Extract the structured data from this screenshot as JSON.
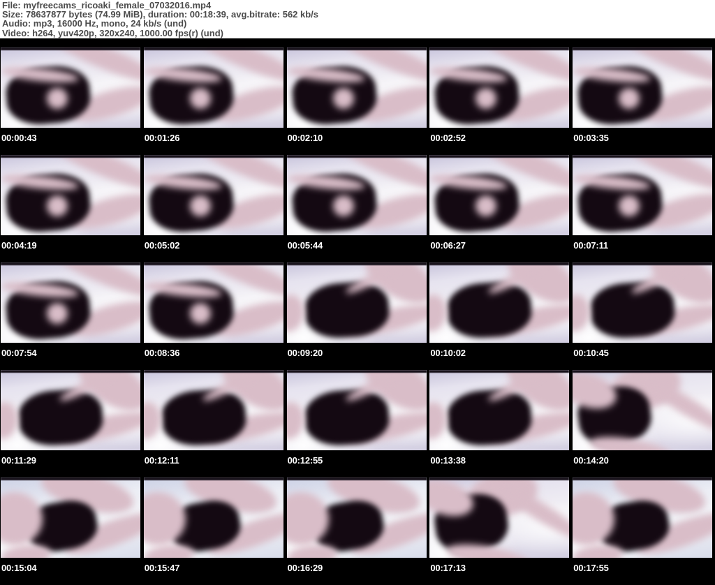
{
  "header": {
    "lines": [
      "File: myfreecams_ricoaki_female_07032016.mp4",
      "Size: 78637877 bytes (74.99 MiB), duration: 00:18:39, avg.bitrate: 562 kb/s",
      "Audio: mp3, 16000 Hz, mono, 24 kb/s (und)",
      "Video: h264, yuv420p, 320x240, 1000.00 fps(r) (und)"
    ]
  },
  "colors": {
    "page_background": "#000000",
    "header_background": "#ffffff",
    "header_text": "#4b4b4b",
    "timestamp_text": "#ffffff",
    "bedding_light": "#f2f0f5",
    "bedding_lavender": "#c7c3db",
    "garment_dark": "#140912",
    "skin_tone": "#d9bdc8"
  },
  "grid": {
    "rows": [
      {
        "cells": [
          {
            "time": "00:00:43",
            "style": "v1"
          },
          {
            "time": "00:01:26",
            "style": "v1"
          },
          {
            "time": "00:02:10",
            "style": "v1"
          },
          {
            "time": "00:02:52",
            "style": "v1"
          },
          {
            "time": "00:03:35",
            "style": "v1"
          }
        ]
      },
      {
        "cells": [
          {
            "time": "00:04:19",
            "style": "v1"
          },
          {
            "time": "00:05:02",
            "style": "v1"
          },
          {
            "time": "00:05:44",
            "style": "v1"
          },
          {
            "time": "00:06:27",
            "style": "v1"
          },
          {
            "time": "00:07:11",
            "style": "v1"
          }
        ]
      },
      {
        "cells": [
          {
            "time": "00:07:54",
            "style": "v1"
          },
          {
            "time": "00:08:36",
            "style": "v1"
          },
          {
            "time": "00:09:20",
            "style": "v2"
          },
          {
            "time": "00:10:02",
            "style": "v2"
          },
          {
            "time": "00:10:45",
            "style": "v2"
          }
        ]
      },
      {
        "cells": [
          {
            "time": "00:11:29",
            "style": "v2"
          },
          {
            "time": "00:12:11",
            "style": "v2"
          },
          {
            "time": "00:12:55",
            "style": "v2"
          },
          {
            "time": "00:13:38",
            "style": "v2"
          },
          {
            "time": "00:14:20",
            "style": "v3"
          }
        ]
      },
      {
        "cells": [
          {
            "time": "00:15:04",
            "style": "v4"
          },
          {
            "time": "00:15:47",
            "style": "v4"
          },
          {
            "time": "00:16:29",
            "style": "v4"
          },
          {
            "time": "00:17:13",
            "style": "v3"
          },
          {
            "time": "00:17:55",
            "style": "v4"
          }
        ]
      }
    ]
  }
}
